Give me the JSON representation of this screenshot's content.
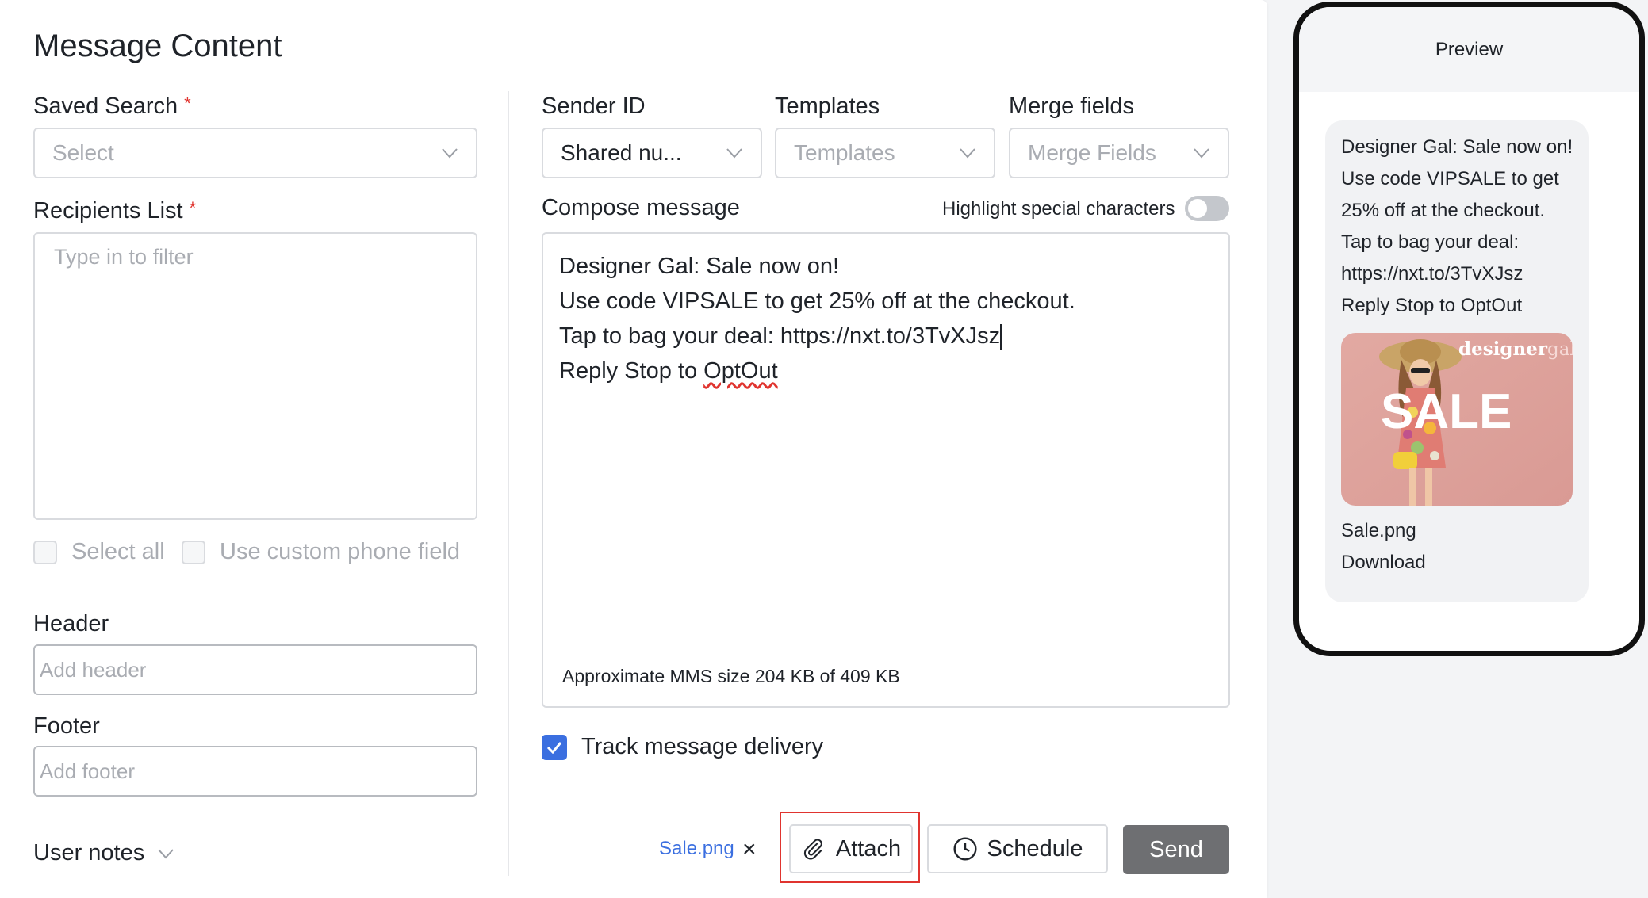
{
  "form": {
    "title": "Message Content",
    "saved_search": {
      "label": "Saved Search",
      "placeholder": "Select"
    },
    "recipients": {
      "label": "Recipients List",
      "placeholder": "Type in to filter"
    },
    "select_all": "Select all",
    "custom_phone": "Use custom phone field",
    "header": {
      "label": "Header",
      "placeholder": "Add header"
    },
    "footer": {
      "label": "Footer",
      "placeholder": "Add footer"
    },
    "user_notes": "User notes"
  },
  "compose": {
    "sender_id": {
      "label": "Sender ID",
      "value": "Shared nu..."
    },
    "templates": {
      "label": "Templates",
      "placeholder": "Templates"
    },
    "merge_fields": {
      "label": "Merge fields",
      "placeholder": "Merge Fields"
    },
    "compose_label": "Compose message",
    "highlight_label": "Highlight special characters",
    "highlight_on": false,
    "message_lines": [
      "Designer Gal: Sale now on!",
      "Use code VIPSALE to get 25% off at the checkout.",
      "Tap to bag your deal: https://nxt.to/3TvXJsz",
      "Reply Stop to "
    ],
    "misspelled_word": "OptOut",
    "mms_size": "Approximate MMS size 204 KB of 409 KB",
    "track_delivery": "Track message delivery",
    "track_checked": true
  },
  "actions": {
    "attached_file": "Sale.png",
    "remove": "×",
    "attach": "Attach",
    "schedule": "Schedule",
    "send": "Send"
  },
  "preview": {
    "title": "Preview",
    "lines": [
      "Designer Gal: Sale now on!",
      "Use code VIPSALE to get",
      "25% off at the checkout.",
      "Tap to bag your deal:",
      "https://nxt.to/3TvXJsz",
      "Reply Stop to OptOut"
    ],
    "image_brand_bold": "designer",
    "image_brand_light": "gal",
    "image_text": "SALE",
    "file_name": "Sale.png",
    "download": "Download"
  },
  "colors": {
    "accent": "#3b6fe0",
    "send_button": "#6e6f72",
    "required": "#e0342f",
    "highlight_box": "#e0342f"
  }
}
